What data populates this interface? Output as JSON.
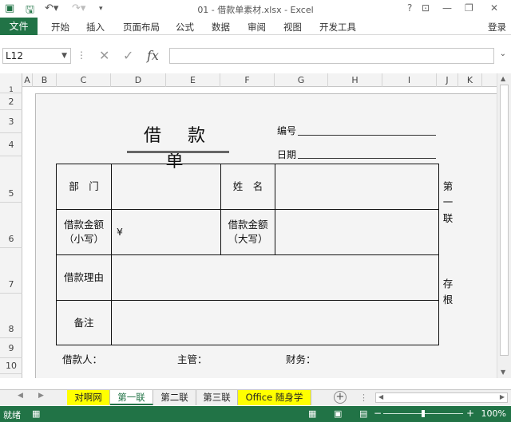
{
  "window": {
    "title": "01 - 借款单素材.xlsx - Excel",
    "qat": {
      "save_icon": "save-icon",
      "undo_icon": "undo-icon",
      "redo_icon": "redo-icon"
    },
    "controls": [
      "?",
      "—",
      "❐",
      "✕"
    ]
  },
  "ribbon": {
    "file_tab": "文件",
    "tabs": [
      "开始",
      "插入",
      "页面布局",
      "公式",
      "数据",
      "审阅",
      "视图",
      "开发工具"
    ],
    "login": "登录"
  },
  "formula_bar": {
    "name_box": "L12",
    "formula": "",
    "cancel_glyph": "✕",
    "enter_glyph": "✓",
    "fx_glyph": "fx"
  },
  "grid": {
    "columns": [
      "A",
      "B",
      "C",
      "D",
      "E",
      "F",
      "G",
      "H",
      "I",
      "J",
      "K"
    ],
    "rows": [
      "1",
      "2",
      "3",
      "4",
      "5",
      "6",
      "7",
      "8",
      "9",
      "10",
      "11"
    ]
  },
  "slip": {
    "title": "借 款 单",
    "number_label": "编号",
    "date_label": "日期",
    "dept_label": "部　门",
    "name_label": "姓　名",
    "amount_lower_label": "借款金额",
    "amount_lower_sub": "（小写）",
    "amount_lower_value": "¥",
    "amount_upper_label": "借款金额",
    "amount_upper_sub": "（大写）",
    "reason_label": "借款理由",
    "remark_label": "备注",
    "stub_copy": [
      "第",
      "一",
      "联"
    ],
    "stub_keep": [
      "存",
      "根"
    ],
    "borrower_label": "借款人：",
    "supervisor_label": "主管：",
    "finance_label": "财务："
  },
  "sheet_tabs": [
    {
      "label": "对啊网",
      "style": "yellow"
    },
    {
      "label": "第一联",
      "style": "active"
    },
    {
      "label": "第二联",
      "style": "normal"
    },
    {
      "label": "第三联",
      "style": "normal"
    },
    {
      "label": "Office 随身学",
      "style": "yellow"
    }
  ],
  "status": {
    "ready": "就绪",
    "zoom": "100%",
    "zoom_level_percent": 100
  }
}
